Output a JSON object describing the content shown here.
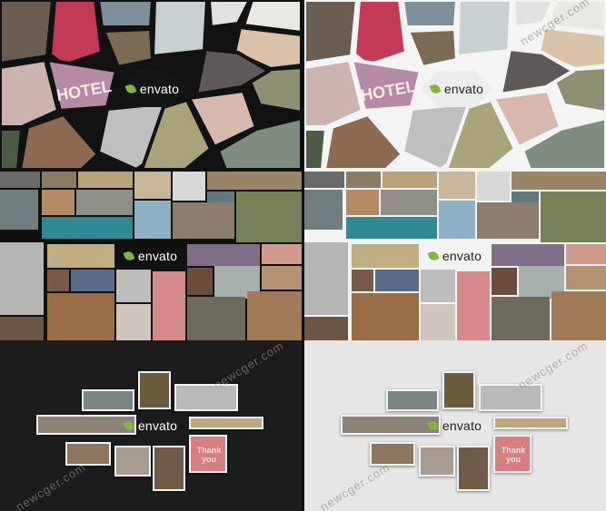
{
  "brand": {
    "logo_text": "envato",
    "leaf_color": "#82b541"
  },
  "watermark": {
    "text": "newcger.com"
  },
  "colors": {
    "dark_bg": "#1c1c1c",
    "light_bg": "#e6e6e6",
    "shard_border_dark": "#121212",
    "shard_border_light": "#f4f4f4",
    "tile_frame": "#f2f2f2"
  },
  "sign_text": "HOTEL",
  "neon_text": "Thank you"
}
